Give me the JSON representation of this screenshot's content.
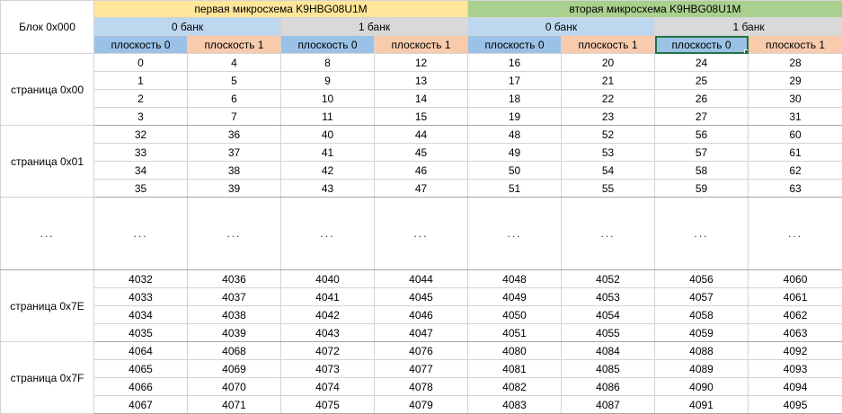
{
  "header": {
    "corner": "Блок 0x000",
    "chips": [
      "первая микросхема K9HBG08U1M",
      "вторая микросхема K9HBG08U1M"
    ],
    "banks": [
      "0 банк",
      "1 банк",
      "0 банк",
      "1 банк"
    ],
    "planes": [
      "плоскость 0",
      "плоскость 1",
      "плоскость 0",
      "плоскость 1",
      "плоскость 0",
      "плоскость 1",
      "плоскость 0",
      "плоскость 1"
    ]
  },
  "groups": [
    {
      "label": "страница 0x00",
      "rows": [
        [
          "0",
          "4",
          "8",
          "12",
          "16",
          "20",
          "24",
          "28"
        ],
        [
          "1",
          "5",
          "9",
          "13",
          "17",
          "21",
          "25",
          "29"
        ],
        [
          "2",
          "6",
          "10",
          "14",
          "18",
          "22",
          "26",
          "30"
        ],
        [
          "3",
          "7",
          "11",
          "15",
          "19",
          "23",
          "27",
          "31"
        ]
      ]
    },
    {
      "label": "страница 0x01",
      "rows": [
        [
          "32",
          "36",
          "40",
          "44",
          "48",
          "52",
          "56",
          "60"
        ],
        [
          "33",
          "37",
          "41",
          "45",
          "49",
          "53",
          "57",
          "61"
        ],
        [
          "34",
          "38",
          "42",
          "46",
          "50",
          "54",
          "58",
          "62"
        ],
        [
          "35",
          "39",
          "43",
          "47",
          "51",
          "55",
          "59",
          "63"
        ]
      ]
    },
    {
      "label": "страница 0x7E",
      "rows": [
        [
          "4032",
          "4036",
          "4040",
          "4044",
          "4048",
          "4052",
          "4056",
          "4060"
        ],
        [
          "4033",
          "4037",
          "4041",
          "4045",
          "4049",
          "4053",
          "4057",
          "4061"
        ],
        [
          "4034",
          "4038",
          "4042",
          "4046",
          "4050",
          "4054",
          "4058",
          "4062"
        ],
        [
          "4035",
          "4039",
          "4043",
          "4047",
          "4051",
          "4055",
          "4059",
          "4063"
        ]
      ]
    },
    {
      "label": "страница 0x7F",
      "rows": [
        [
          "4064",
          "4068",
          "4072",
          "4076",
          "4080",
          "4084",
          "4088",
          "4092"
        ],
        [
          "4065",
          "4069",
          "4073",
          "4077",
          "4081",
          "4085",
          "4089",
          "4093"
        ],
        [
          "4066",
          "4070",
          "4074",
          "4078",
          "4082",
          "4086",
          "4090",
          "4094"
        ],
        [
          "4067",
          "4071",
          "4075",
          "4079",
          "4083",
          "4087",
          "4091",
          "4095"
        ]
      ]
    }
  ],
  "ellipsis": {
    "label": "...",
    "cells": [
      "...",
      "...",
      "...",
      "...",
      "...",
      "...",
      "...",
      "..."
    ]
  },
  "colors": {
    "chip1": "#ffe699",
    "chip2": "#a9d08e",
    "bank_blue": "#bdd7ee",
    "bank_gray": "#d9d9d9",
    "plane_blue": "#9bc2e6",
    "plane_orange": "#f8cbad",
    "selection": "#217346"
  }
}
